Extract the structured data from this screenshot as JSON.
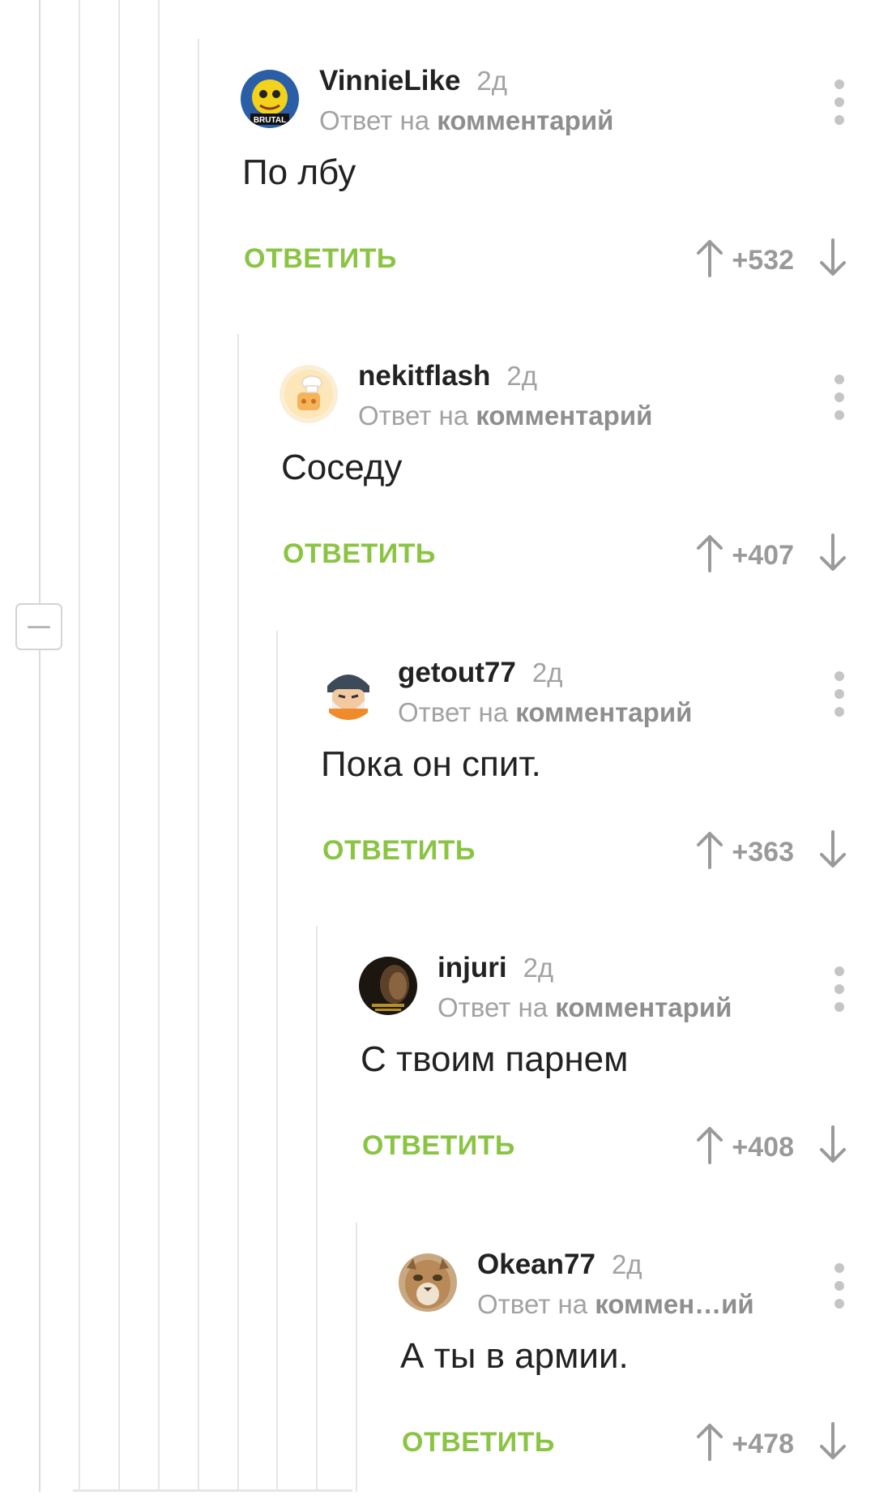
{
  "comments": [
    {
      "username": "VinnieLike",
      "time": "2д",
      "reply_prefix": "Ответ на",
      "reply_target": "комментарий",
      "text": "По лбу",
      "reply_label": "ОТВЕТИТЬ",
      "score": "+532",
      "avatar_badge": "BRUTAL"
    },
    {
      "username": "nekitflash",
      "time": "2д",
      "reply_prefix": "Ответ на",
      "reply_target": "комментарий",
      "text": "Соседу",
      "reply_label": "ОТВЕТИТЬ",
      "score": "+407"
    },
    {
      "username": "getout77",
      "time": "2д",
      "reply_prefix": "Ответ на",
      "reply_target": "комментарий",
      "text": "Пока он спит.",
      "reply_label": "ОТВЕТИТЬ",
      "score": "+363"
    },
    {
      "username": "injuri",
      "time": "2д",
      "reply_prefix": "Ответ на",
      "reply_target": "комментарий",
      "text": "С твоим парнем",
      "reply_label": "ОТВЕТИТЬ",
      "score": "+408"
    },
    {
      "username": "Okean77",
      "time": "2д",
      "reply_prefix": "Ответ на",
      "reply_target": "коммен…ий",
      "text": "А ты в армии.",
      "reply_label": "ОТВЕТИТЬ",
      "score": "+478"
    }
  ],
  "icons": {
    "more": "vertical-dots-icon",
    "upvote": "arrow-up-icon",
    "downvote": "arrow-down-icon",
    "collapse": "minus-icon"
  },
  "colors": {
    "reply_green": "#8ac443",
    "muted_gray": "#a2a2a2",
    "thread_line": "#e6e6e6"
  }
}
